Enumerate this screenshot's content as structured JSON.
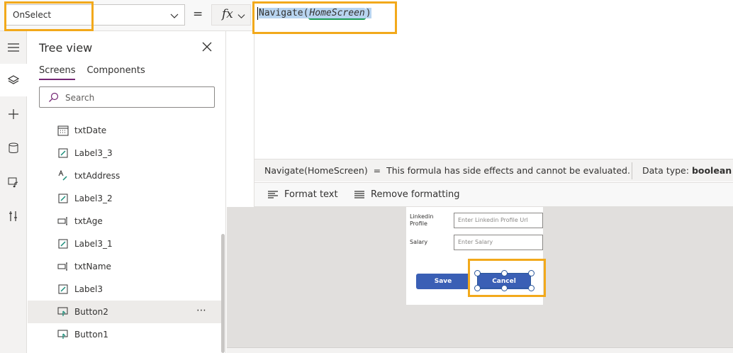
{
  "formula_bar": {
    "property": "OnSelect",
    "equals": "=",
    "fx_label": "fx",
    "formula_function": "Navigate(",
    "formula_param": "HomeScreen",
    "formula_close": ")",
    "result_text": "Navigate(HomeScreen)  =  This formula has side effects and cannot be evaluated.",
    "data_type_label": "Data type: ",
    "data_type_value": "boolean",
    "format_text": "Format text",
    "remove_formatting": "Remove formatting"
  },
  "tree_view": {
    "title": "Tree view",
    "tabs": [
      "Screens",
      "Components"
    ],
    "search_placeholder": "Search",
    "items": [
      {
        "label": "txtDate",
        "icon": "calendar-icon"
      },
      {
        "label": "Label3_3",
        "icon": "edit-label-icon"
      },
      {
        "label": "txtAddress",
        "icon": "text-label-icon"
      },
      {
        "label": "Label3_2",
        "icon": "edit-label-icon"
      },
      {
        "label": "txtAge",
        "icon": "text-input-icon"
      },
      {
        "label": "Label3_1",
        "icon": "edit-label-icon"
      },
      {
        "label": "txtName",
        "icon": "text-input-icon"
      },
      {
        "label": "Label3",
        "icon": "edit-label-icon"
      },
      {
        "label": "Button2",
        "icon": "button-icon",
        "selected": true
      },
      {
        "label": "Button1",
        "icon": "button-icon"
      }
    ],
    "more_label": "⋯"
  },
  "canvas": {
    "linkedin_label": "Linkedin\nProfile",
    "linkedin_placeholder": "Enter Linkedin Profile Url",
    "salary_label": "Salary",
    "salary_placeholder": "Enter Salary",
    "save_label": "Save",
    "cancel_label": "Cancel"
  },
  "colors": {
    "highlight": "#f2a91b",
    "button": "#3a5fb5",
    "tab_active": "#742774"
  }
}
